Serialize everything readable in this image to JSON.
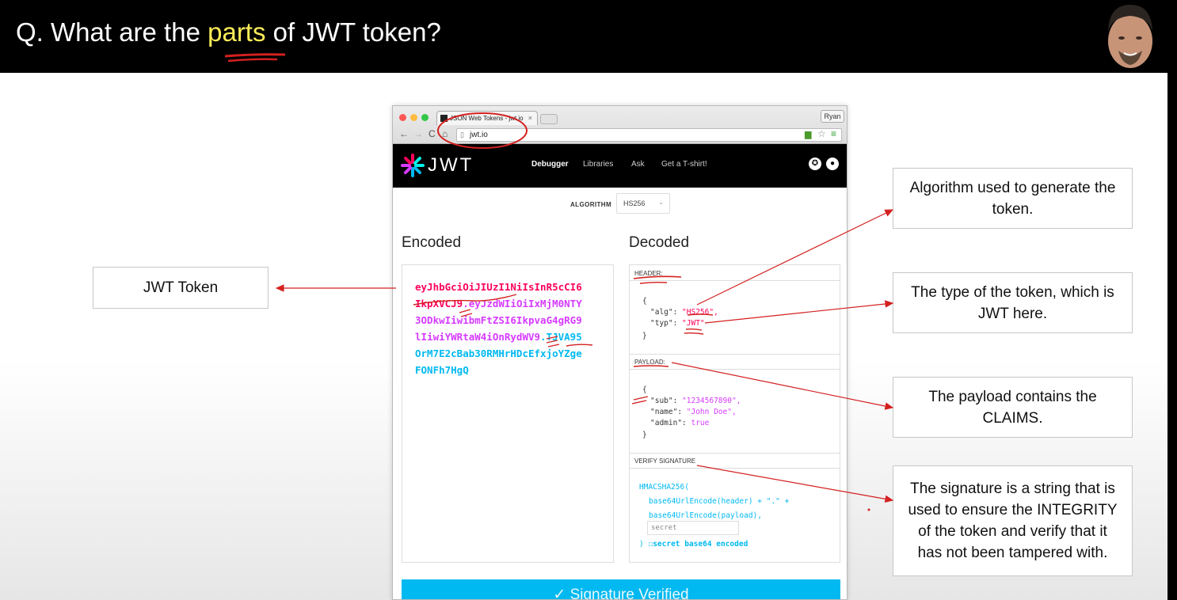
{
  "slide": {
    "title_prefix": "Q. What are the ",
    "title_highlight": "parts",
    "title_suffix": " of JWT token?"
  },
  "callouts": {
    "jwt_token": "JWT Token",
    "algorithm": "Algorithm used to generate the token.",
    "type": "The type of the token, which is JWT here.",
    "payload": "The payload contains the CLAIMS.",
    "signature": "The signature is a string that is used to ensure the INTEGRITY of the token and verify that it has not been tampered with."
  },
  "browser": {
    "tab_title": "JSON Web Tokens - jwt.io",
    "tab_close": "×",
    "user_button": "Ryan",
    "url": "jwt.io",
    "nav_back": "←",
    "nav_forward": "→",
    "nav_reload": "C",
    "nav_home": "⌂",
    "star": "☆",
    "menu": "≡"
  },
  "jwt_site": {
    "logo_text": "JWT",
    "nav": [
      "Debugger",
      "Libraries",
      "Ask",
      "Get a T-shirt!"
    ],
    "algorithm_label": "ALGORITHM",
    "algorithm_value": "HS256",
    "encoded_title": "Encoded",
    "decoded_title": "Decoded",
    "encoded_lines": [
      {
        "parts": [
          "eyJhbGciOiJIUzI1NiIsInR5cCI6",
          "",
          ""
        ]
      },
      {
        "parts": [
          "IkpXVCJ9",
          ".eyJzdWIiOiIxMjM0NTY",
          ""
        ]
      },
      {
        "parts": [
          "",
          "3ODkwIiwibmFtZSI6IkpvaG4gRG9",
          ""
        ]
      },
      {
        "parts": [
          "",
          "lIiwiYWRtaW4iOnRydWV9",
          ".TJVA95"
        ]
      },
      {
        "parts": [
          "",
          "",
          "OrM7E2cBab30RMHrHDcEfxjoYZge"
        ]
      },
      {
        "parts": [
          "",
          "",
          "FONFh7HgQ"
        ]
      }
    ],
    "header_label": "HEADER:",
    "payload_label": "PAYLOAD:",
    "verify_label": "VERIFY SIGNATURE",
    "header_json": {
      "open": "{",
      "alg_key": "\"alg\": ",
      "alg_val": "\"HS256\",",
      "typ_key": "\"typ\": ",
      "typ_val": "\"JWT\"",
      "close": "}"
    },
    "payload_json": {
      "open": "{",
      "sub_key": "\"sub\": ",
      "sub_val": "\"1234567890\",",
      "name_key": "\"name\": ",
      "name_val": "\"John Doe\",",
      "admin_key": "\"admin\": ",
      "admin_val": "true",
      "close": "}"
    },
    "signature_code": {
      "line1": "HMACSHA256(",
      "line2": "base64UrlEncode(header) + \".\" +",
      "line3": "base64UrlEncode(payload),",
      "secret_placeholder": "secret",
      "line5_close": ")",
      "checkbox_label": "secret base64 encoded"
    },
    "verified_button": "Signature Verified",
    "verified_icon": "check-circle-icon"
  },
  "colors": {
    "header_color": "#fb015b",
    "payload_color": "#d63aff",
    "signature_color": "#00b9f1",
    "annotation_red": "#d42020",
    "title_highlight": "#ffee58"
  }
}
